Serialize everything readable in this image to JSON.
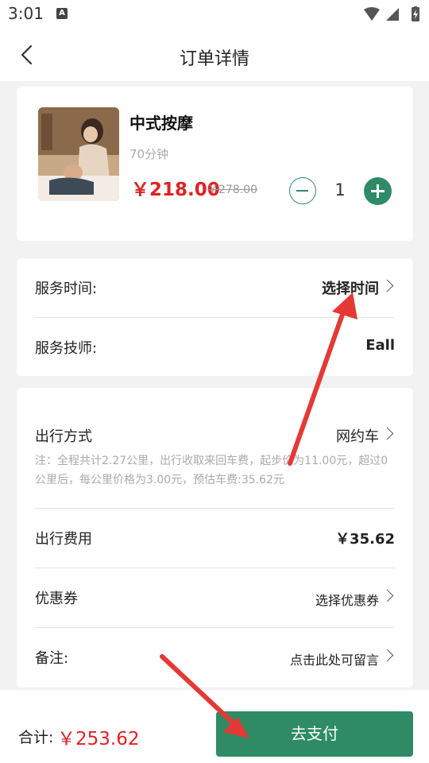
{
  "status_bar": {
    "time": "3:01",
    "a_badge": "A",
    "icons": [
      "wifi-icon",
      "signal-icon",
      "battery-icon"
    ]
  },
  "header": {
    "title": "订单详情",
    "back_icon": "chevron-left-icon"
  },
  "product": {
    "title": "中式按摩",
    "duration": "70分钟",
    "price": "￥218.00",
    "original_price": "￥278.00",
    "quantity": "1"
  },
  "service": {
    "time_label": "服务时间:",
    "time_value": "选择时间",
    "tech_label": "服务技师:",
    "tech_value": "Eall"
  },
  "travel": {
    "mode_label": "出行方式",
    "mode_value": "网约车",
    "note": "注：全程共计2.27公里，出行收取来回车费，起步价为11.00元，超过0公里后，每公里价格为3.00元，预估车费:35.62元",
    "fee_label": "出行费用",
    "fee_value": "￥35.62",
    "coupon_label": "优惠券",
    "coupon_value": "选择优惠券",
    "remark_label": "备注:",
    "remark_value": "点击此处可留言"
  },
  "footer": {
    "total_label": "合计:",
    "total_value": "￥253.62",
    "pay_label": "去支付"
  },
  "colors": {
    "accent": "#2e8b66",
    "price": "#e12222",
    "annotation_arrow": "#e53935"
  }
}
